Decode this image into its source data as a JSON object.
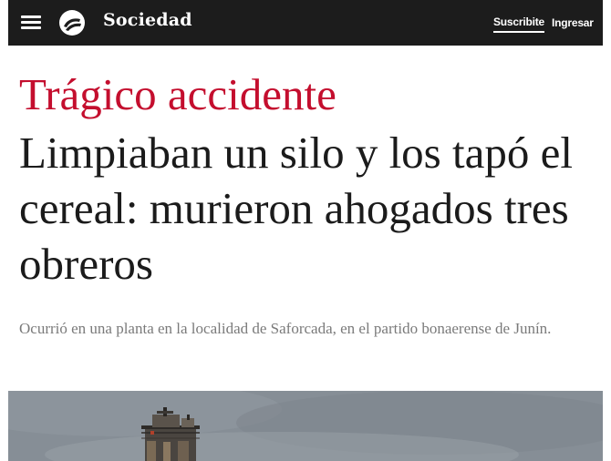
{
  "header": {
    "logo_icon": "clarin-logo-icon",
    "menu_icon": "hamburger-menu-icon",
    "section": "Sociedad",
    "subscribe_label": "Suscribite",
    "login_label": "Ingresar",
    "background_color": "#1c1c1c"
  },
  "article": {
    "kicker": "Trágico accidente",
    "kicker_color": "#c40e2e",
    "title": "Limpiaban un silo y los tapó el cereal: murieron ahogados tres obreros",
    "summary": "Ocurrió en una planta en la localidad de Saforcada, en el partido bonaerense de Junín.",
    "image": {
      "subject": "grain silo structure against overcast sky"
    }
  }
}
